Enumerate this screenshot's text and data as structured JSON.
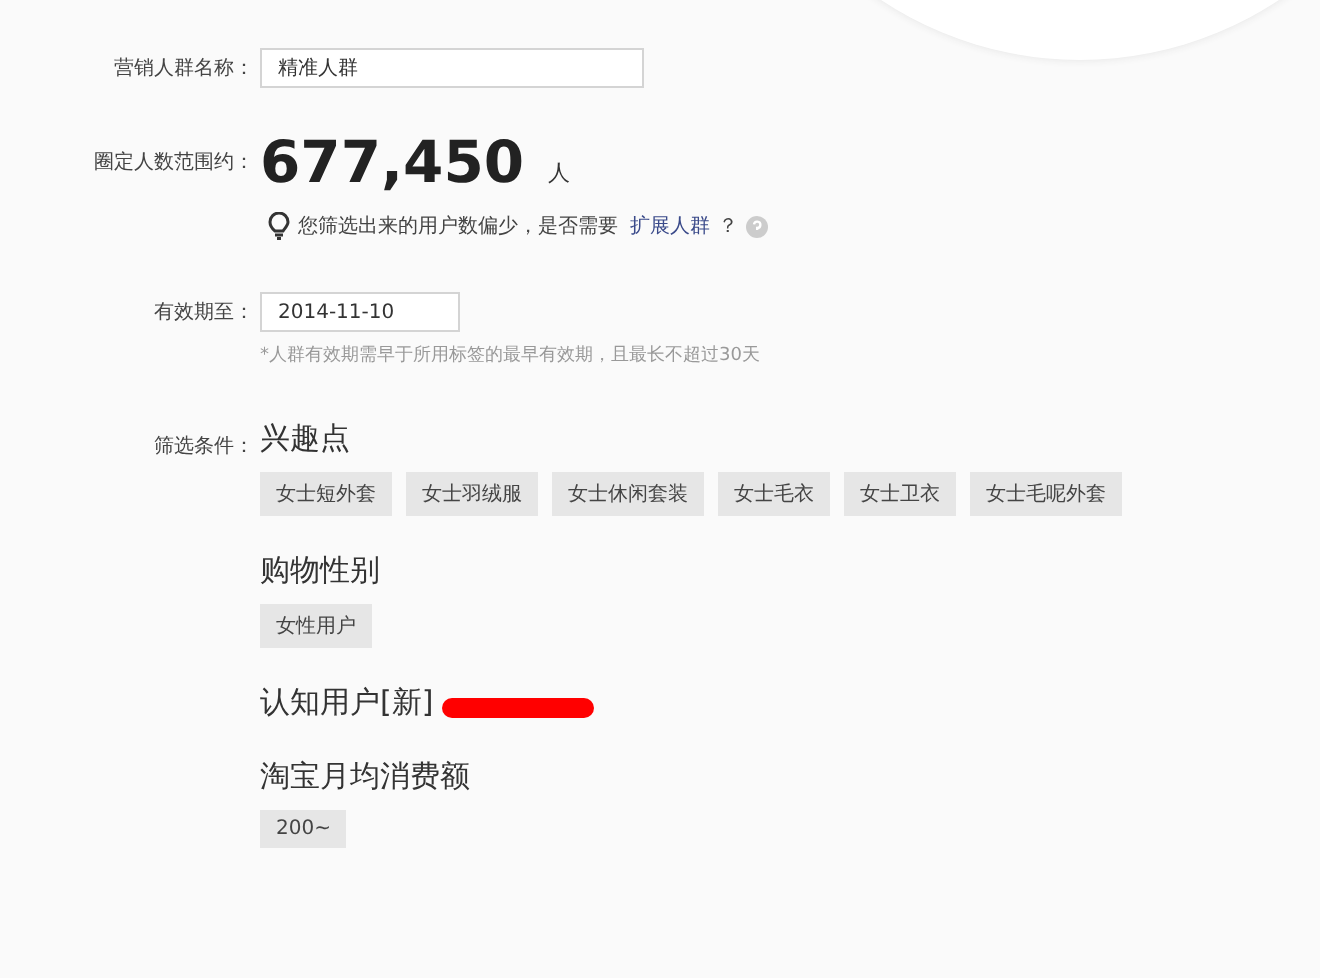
{
  "name_field": {
    "label": "营销人群名称：",
    "value": "精准人群"
  },
  "count": {
    "label": "圈定人数范围约：",
    "value": "677,450",
    "unit": "人"
  },
  "hint": {
    "text": "您筛选出来的用户数偏少，是否需要",
    "link": "扩展人群",
    "suffix": "？"
  },
  "expiry": {
    "label": "有效期至：",
    "value": "2014-11-10",
    "note": "*人群有效期需早于所用标签的最早有效期，且最长不超过30天"
  },
  "filters": {
    "label": "筛选条件：",
    "sections": [
      {
        "title": "兴趣点",
        "redacted": false,
        "tags": [
          "女士短外套",
          "女士羽绒服",
          "女士休闲套装",
          "女士毛衣",
          "女士卫衣",
          "女士毛呢外套"
        ]
      },
      {
        "title": "购物性别",
        "redacted": false,
        "tags": [
          "女性用户"
        ]
      },
      {
        "title": "认知用户[新]",
        "redacted": true
      },
      {
        "title": "淘宝月均消费额",
        "redacted": false,
        "tags": [
          "200~"
        ]
      }
    ]
  }
}
